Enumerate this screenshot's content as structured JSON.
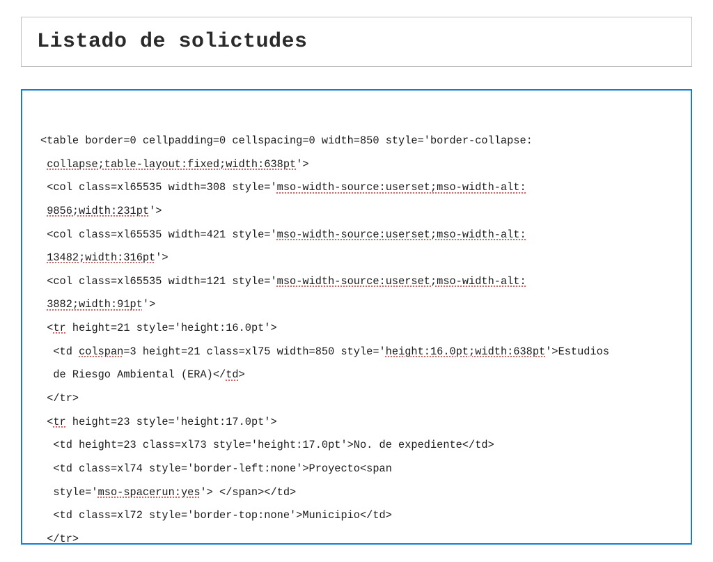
{
  "header": {
    "title": "Listado de solictudes"
  },
  "code": {
    "l1a": "<table border=0 cellpadding=0 cellspacing=0 width=850 style='border-collapse:",
    "l1b": "collapse;table-layout:fixed;width:638pt",
    "l1c": "'>",
    "l2a": " <col class=xl65535 width=308 style='",
    "l2b": "mso-width-source:userset;mso-width-alt:",
    "l3a": "9856;width:231pt",
    "l3b": "'>",
    "l4a": " <col class=xl65535 width=421 style='",
    "l4b": "mso-width-source:userset;mso-width-alt:",
    "l5a": "13482;width:316pt",
    "l5b": "'>",
    "l6a": " <col class=xl65535 width=121 style='",
    "l6b": "mso-width-source:userset;mso-width-alt:",
    "l7a": "3882;width:91pt",
    "l7b": "'>",
    "l8a": " <",
    "l8b": "tr",
    "l8c": " height=21 style='height:16.0pt'>",
    "l9a": "  <td ",
    "l9b": "colspan",
    "l9c": "=3 height=21 class=xl75 width=850 style='",
    "l9d": "height:16.0pt;width:638pt",
    "l9e": "'>Estudios",
    "l10": "  de Riesgo Ambiental (ERA)</",
    "l10b": "td",
    "l10c": ">",
    "l11": " </tr>",
    "l12a": " <",
    "l12b": "tr",
    "l12c": " height=23 style='height:17.0pt'>",
    "l13": "  <td height=23 class=xl73 style='height:17.0pt'>No. de expediente</td>",
    "l14": "  <td class=xl74 style='border-left:none'>Proyecto<span",
    "l15a": "  style='",
    "l15b": "mso-spacerun:yes",
    "l15c": "'> </span></td>",
    "l16": "  <td class=xl72 style='border-top:none'>Municipio</td>",
    "l17": " </tr>"
  }
}
